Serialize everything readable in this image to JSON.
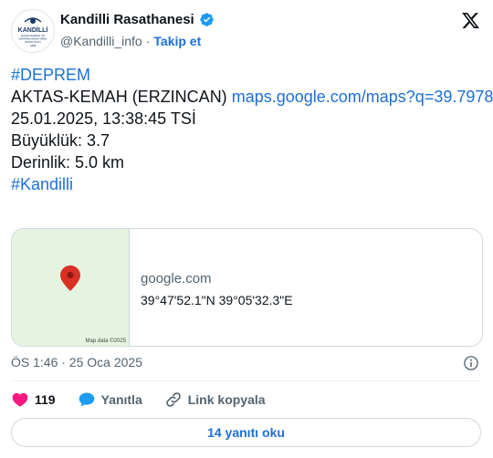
{
  "author": {
    "name": "Kandilli Rasathanesi",
    "handle": "@Kandilli_info",
    "separator": "·",
    "follow_label": "Takip et",
    "avatar_text": [
      "KANDİLLİ",
      "RASATHANESİ VE",
      "DEPREM ARAŞTIRMA",
      "ENSTİTÜSÜ",
      "1868"
    ]
  },
  "tweet": {
    "hashtag1": "#DEPREM",
    "location": "AKTAS-KEMAH (ERZINCAN)",
    "map_link": "maps.google.com/maps?q=39.7978…",
    "datetime": "25.01.2025, 13:38:45 TSİ",
    "magnitude": "Büyüklük: 3.7",
    "depth": "Derinlik: 5.0 km",
    "hashtag2": "#Kandilli"
  },
  "card": {
    "domain": "google.com",
    "coordinates": "39°47'52.1\"N 39°05'32.3\"E",
    "map_credit": "Map data ©2025"
  },
  "meta": {
    "timestamp": "ÖS 1:46 · 25 Oca 2025"
  },
  "actions": {
    "like_count": "119",
    "reply_label": "Yanıtla",
    "copy_link_label": "Link kopyala"
  },
  "read_replies_label": "14 yanıtı oku",
  "colors": {
    "link": "#1d6fd6",
    "verified": "#1d9bf0",
    "like": "#f91880",
    "map_bg": "#e5f4e0",
    "pin": "#d93025"
  }
}
